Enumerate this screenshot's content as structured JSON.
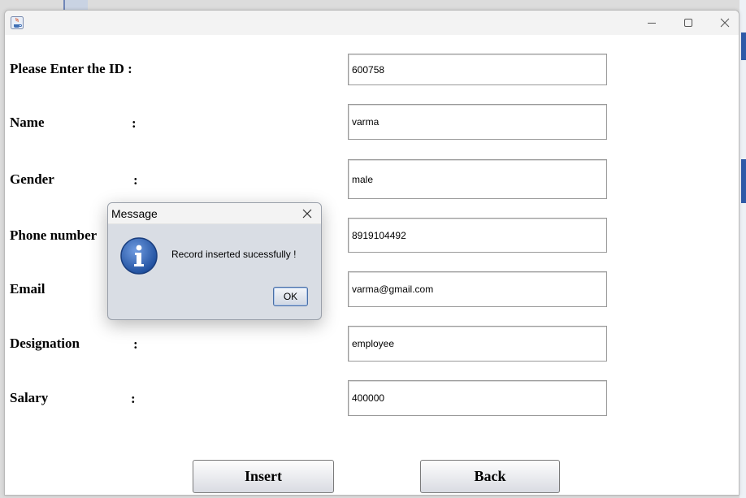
{
  "window": {
    "title": "",
    "controls": {
      "minimize": "minimize-icon",
      "maximize": "maximize-icon",
      "close": "close-icon"
    }
  },
  "form": {
    "id_label": "Please Enter the ID :",
    "name_label": "Name",
    "gender_label": "Gender",
    "phone_label": "Phone number",
    "email_label": "Email",
    "designation_label": "Designation",
    "salary_label": "Salary",
    "colon": ":",
    "id_value": "600758",
    "name_value": "varma",
    "gender_value": "male",
    "phone_value": "8919104492",
    "email_value": "varma@gmail.com",
    "designation_value": "employee",
    "salary_value": "400000"
  },
  "buttons": {
    "insert": "Insert",
    "back": "Back"
  },
  "dialog": {
    "title": "Message",
    "message": "Record inserted sucessfully !",
    "ok": "OK",
    "icon": "info-icon"
  },
  "colors": {
    "info_blue": "#2f62b3",
    "dialog_bg": "#d9dde4",
    "ok_border": "#4a6fa5"
  }
}
